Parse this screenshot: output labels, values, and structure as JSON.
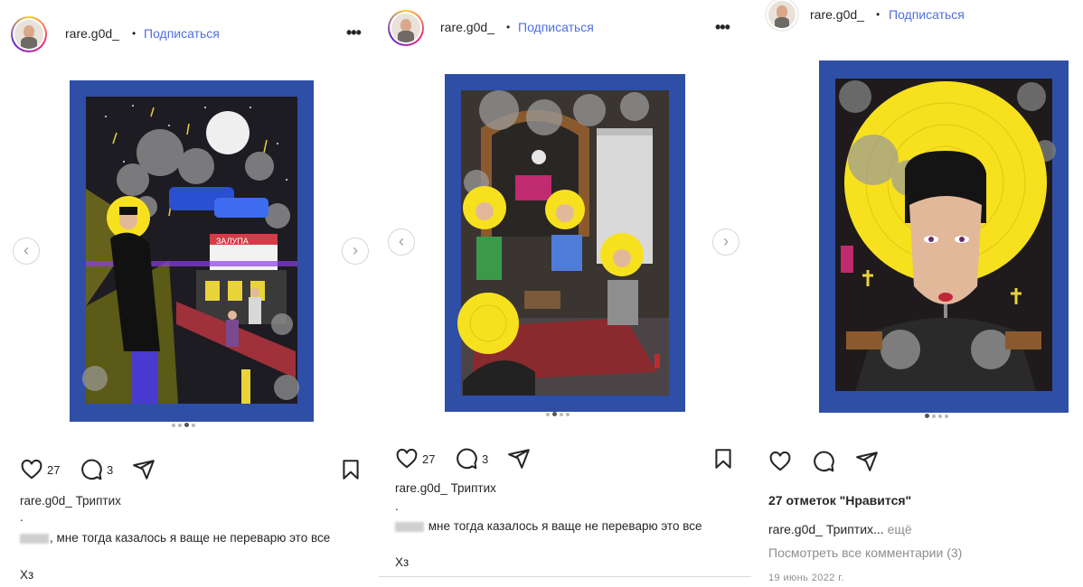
{
  "posts": [
    {
      "username": "rare.g0d_",
      "separator": "•",
      "follow_label": "Подписаться",
      "more_label": "•••",
      "prev_label": "‹",
      "next_label": "›",
      "carousel": {
        "count": 4,
        "active": 3
      },
      "likes_count": "27",
      "comments_count": "3",
      "caption_user": "rare.g0d_",
      "caption_text": "Триптих",
      "caption_dot": ".",
      "comment_text": ", мне тогда казалось я ваще не переварю это все",
      "comment_line2": "Хз"
    },
    {
      "username": "rare.g0d_",
      "separator": "•",
      "follow_label": "Подписаться",
      "more_label": "•••",
      "prev_label": "‹",
      "next_label": "›",
      "carousel": {
        "count": 4,
        "active": 2
      },
      "likes_count": "27",
      "comments_count": "3",
      "caption_user": "rare.g0d_",
      "caption_text": "Триптих",
      "caption_dot": ".",
      "comment_text": " мне тогда казалось я ваще не переварю это все",
      "comment_line2": "Хз"
    },
    {
      "username": "rare.g0d_",
      "separator": "•",
      "follow_label": "Подписаться",
      "carousel": {
        "count": 4,
        "active": 1
      },
      "likes_text": "27 отметок \"Нравится\"",
      "caption_user": "rare.g0d_",
      "caption_text": "Триптих...",
      "caption_more": "ещё",
      "view_comments": "Посмотреть все комментарии (3)",
      "date": "19 июнь 2022 г."
    }
  ],
  "colors": {
    "frame_blue": "#2f4ea6",
    "halo_yellow": "#f7e11e",
    "link_blue": "#4f6fe0"
  },
  "icons": [
    "heart-icon",
    "comment-icon",
    "share-icon",
    "bookmark-icon",
    "more-icon",
    "chevron-left-icon",
    "chevron-right-icon"
  ]
}
